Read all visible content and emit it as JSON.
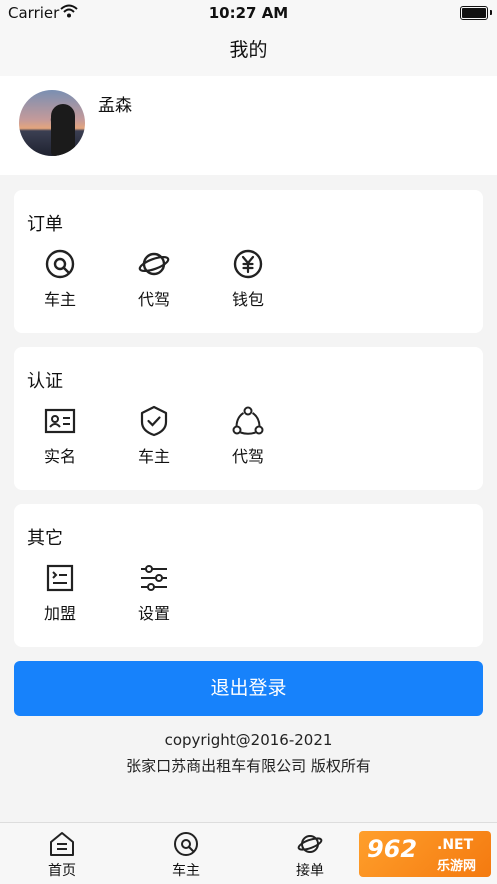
{
  "status_bar": {
    "carrier": "Carrier",
    "time": "10:27 AM"
  },
  "nav": {
    "title": "我的"
  },
  "profile": {
    "name": "孟森"
  },
  "sections": {
    "orders": {
      "title": "订单",
      "items": [
        {
          "label": "车主",
          "icon": "steering-icon"
        },
        {
          "label": "代驾",
          "icon": "planet-icon"
        },
        {
          "label": "钱包",
          "icon": "yen-wallet-icon"
        }
      ]
    },
    "certification": {
      "title": "认证",
      "items": [
        {
          "label": "实名",
          "icon": "id-card-icon"
        },
        {
          "label": "车主",
          "icon": "shield-check-icon"
        },
        {
          "label": "代驾",
          "icon": "share-nodes-icon"
        }
      ]
    },
    "other": {
      "title": "其它",
      "items": [
        {
          "label": "加盟",
          "icon": "list-icon"
        },
        {
          "label": "设置",
          "icon": "sliders-icon"
        }
      ]
    }
  },
  "logout": {
    "label": "退出登录"
  },
  "footer": {
    "copyright": "copyright@2016-2021",
    "company": "张家口苏商出租车有限公司 版权所有"
  },
  "tabbar": {
    "tabs": [
      {
        "label": "首页",
        "icon": "home-icon"
      },
      {
        "label": "车主",
        "icon": "steering-icon"
      },
      {
        "label": "接单",
        "icon": "planet-icon"
      }
    ]
  },
  "watermark": {
    "number": "962",
    "domain": ".NET",
    "text": "乐游网"
  },
  "colors": {
    "primary": "#1782fb",
    "background": "#f4f4f4"
  }
}
